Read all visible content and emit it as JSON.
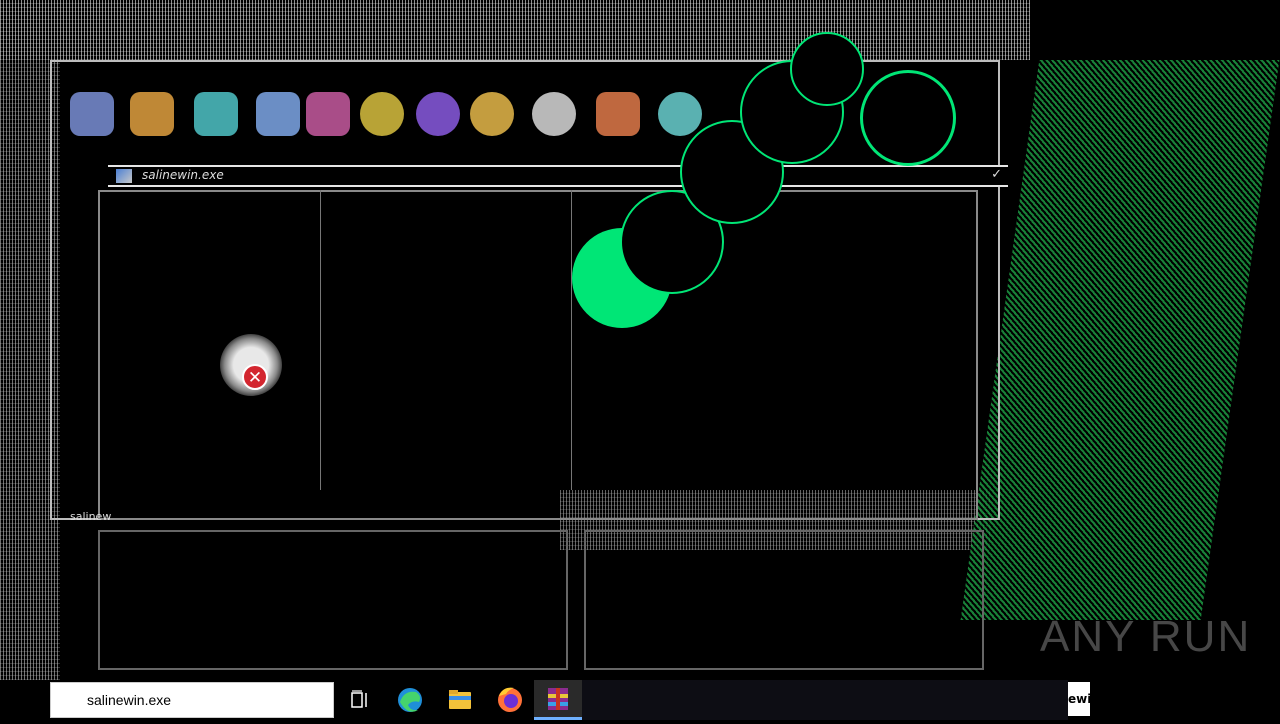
{
  "window": {
    "title": "salinewin.exe"
  },
  "desktop": {
    "label_fragment": "salinew",
    "app_icons": [
      {
        "icon": "app-icon-1",
        "color": "#7a8fd6"
      },
      {
        "icon": "app-icon-2",
        "color": "#e0a040"
      },
      {
        "icon": "app-icon-3",
        "color": "#4fc3c7"
      },
      {
        "icon": "app-icon-4",
        "color": "#7ea7e8"
      },
      {
        "icon": "app-icon-5",
        "color": "#c75aa0"
      },
      {
        "icon": "app-icon-6",
        "color": "#d8c040"
      },
      {
        "icon": "app-icon-7",
        "color": "#8a5ae0"
      },
      {
        "icon": "app-icon-8",
        "color": "#e6b84a"
      },
      {
        "icon": "app-icon-9",
        "color": "#d8d8d8"
      },
      {
        "icon": "app-icon-10",
        "color": "#e07a4a"
      },
      {
        "icon": "app-icon-11",
        "color": "#6ad0d0"
      }
    ],
    "error_icon": "error-icon",
    "watermark": "ANY RUN"
  },
  "taskbar": {
    "search_value": "salinewin.exe",
    "buttons": [
      {
        "name": "task-view-icon"
      },
      {
        "name": "edge-icon"
      },
      {
        "name": "file-explorer-icon"
      },
      {
        "name": "firefox-icon"
      },
      {
        "name": "winrar-icon"
      }
    ],
    "corner_text": "ewi"
  },
  "colors": {
    "accent_green": "#00e676",
    "error_red": "#d3262f",
    "taskbar_highlight": "#6fb1ff"
  }
}
